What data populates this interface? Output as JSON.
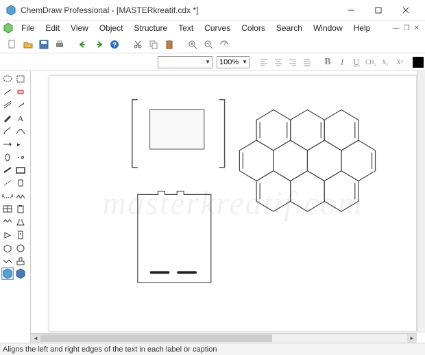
{
  "window": {
    "title": "ChemDraw Professional - [MASTERkreatif.cdx *]"
  },
  "menu": {
    "items": [
      "File",
      "Edit",
      "View",
      "Object",
      "Structure",
      "Text",
      "Curves",
      "Colors",
      "Search",
      "Window",
      "Help"
    ]
  },
  "toolbar2": {
    "zoom": "100%"
  },
  "format": {
    "bold": "B",
    "italic": "I",
    "underline": "U",
    "ch2": "CH₂",
    "x2sub": "X₂",
    "x2sup": "X²"
  },
  "status": {
    "text": "Aligns the left and right edges of the text in each label or caption"
  },
  "watermark": "masterkreatif.com"
}
